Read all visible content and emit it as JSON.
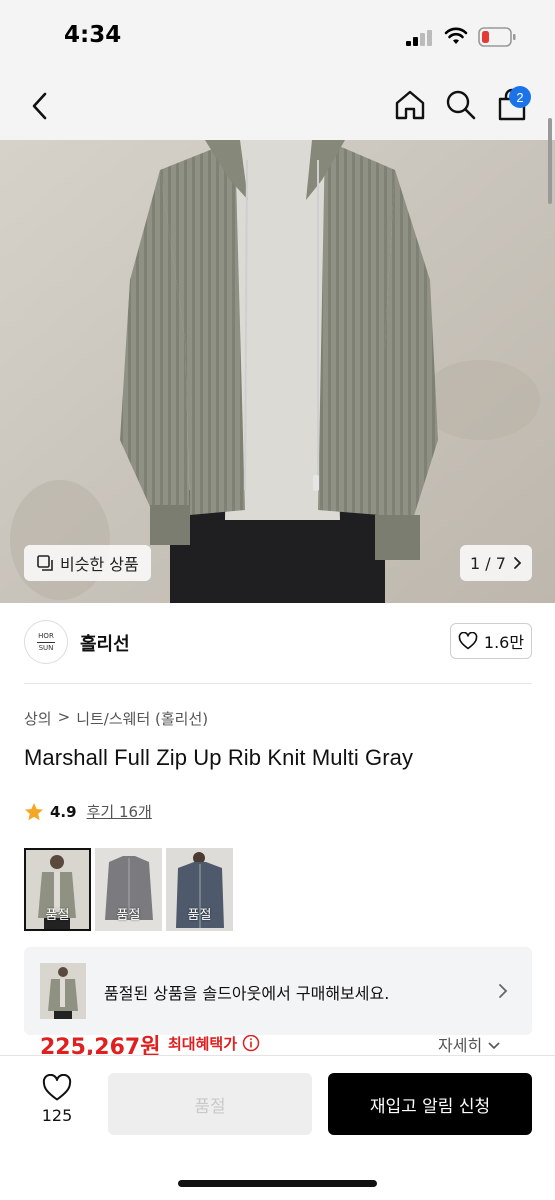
{
  "status": {
    "time": "4:34"
  },
  "nav": {
    "cart_count": "2"
  },
  "hero": {
    "similar_label": "비슷한 상품",
    "page": "1 / 7"
  },
  "brand": {
    "name": "홀리선",
    "logo_top": "HOR",
    "logo_bottom": "SUN",
    "likes": "1.6만"
  },
  "breadcrumb": {
    "level1": "상의",
    "sep": ">",
    "level2": "니트/스웨터 (홀리선)"
  },
  "product": {
    "title": "Marshall Full Zip Up Rib Knit Multi Gray"
  },
  "rating": {
    "score": "4.9",
    "reviews": "후기 16개"
  },
  "thumbnails": [
    {
      "label": "품절",
      "color": "#8f9283"
    },
    {
      "label": "품절",
      "color": "#7b7b7f"
    },
    {
      "label": "품절",
      "color": "#4e5a6c"
    }
  ],
  "banner": {
    "text": "품절된 상품을 솔드아웃에서 구매해보세요."
  },
  "price": {
    "amount": "225,267원",
    "benefit": "최대혜택가",
    "detail": "자세히"
  },
  "bottom": {
    "favorites": "125",
    "soldout_label": "품절",
    "restock_label": "재입고 알림 신청"
  },
  "colors": {
    "accent_blue": "#1a73e8",
    "price_red": "#e02020",
    "cta_black": "#000000"
  }
}
